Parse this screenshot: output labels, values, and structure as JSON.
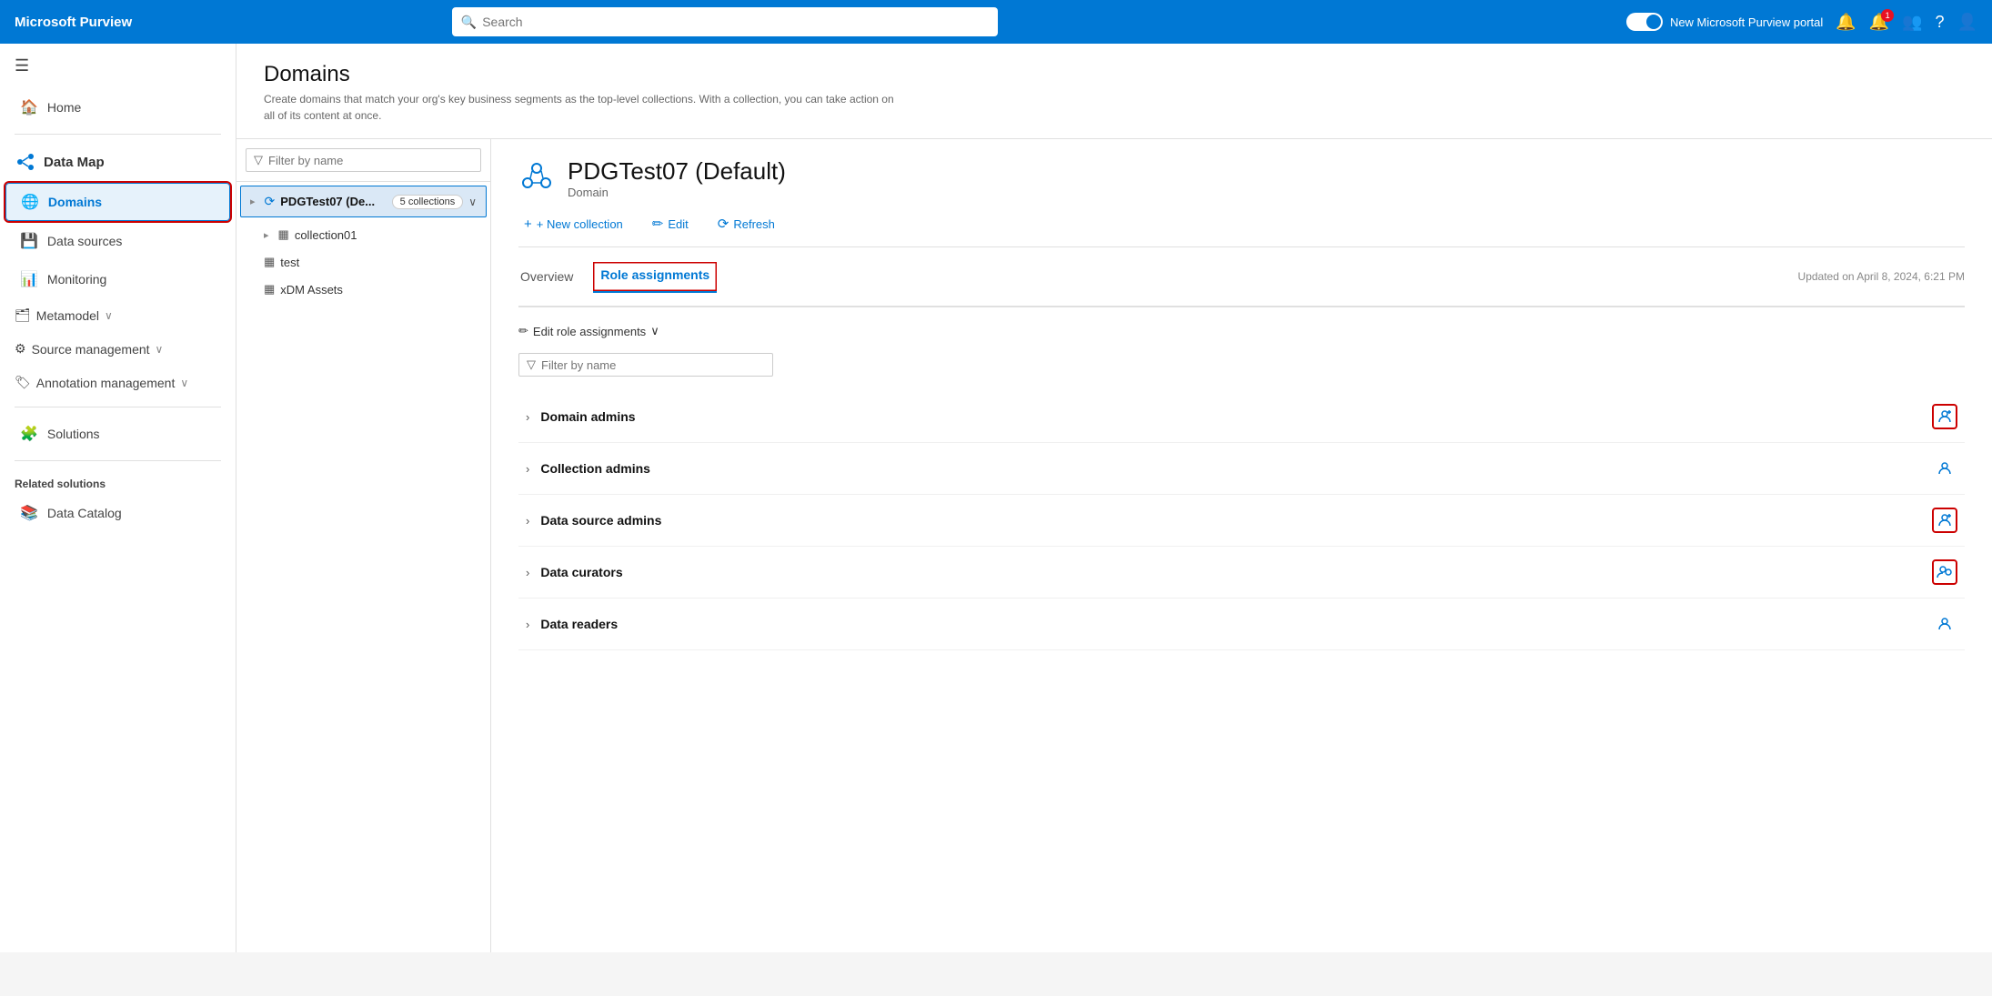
{
  "app": {
    "brand": "Microsoft Purview",
    "toggle_label": "New Microsoft Purview portal"
  },
  "topnav": {
    "search_placeholder": "Search"
  },
  "sidebar": {
    "hamburger": "☰",
    "home_label": "Home",
    "data_map_label": "Data Map",
    "items": [
      {
        "id": "domains",
        "label": "Domains",
        "active": true
      },
      {
        "id": "data-sources",
        "label": "Data sources",
        "active": false
      },
      {
        "id": "monitoring",
        "label": "Monitoring",
        "active": false
      },
      {
        "id": "metamodel",
        "label": "Metamodel",
        "active": false,
        "has_chevron": true
      },
      {
        "id": "source-management",
        "label": "Source management",
        "active": false,
        "has_chevron": true
      },
      {
        "id": "annotation-management",
        "label": "Annotation management",
        "active": false,
        "has_chevron": true
      }
    ],
    "divider_after_metamodel": true,
    "solutions_label": "Solutions",
    "solutions_item": "Solutions",
    "related_solutions_label": "Related solutions",
    "related_solutions_items": [
      {
        "id": "data-catalog",
        "label": "Data Catalog"
      }
    ]
  },
  "page": {
    "title": "Domains",
    "subtitle": "Create domains that match your org's key business segments as the top-level collections. With a collection, you can take action on all of its content at once."
  },
  "filter": {
    "placeholder": "Filter by name"
  },
  "collections": {
    "root": {
      "name": "PDGTest07 (De...",
      "badge": "5 collections",
      "expanded": true
    },
    "children": [
      {
        "name": "collection01"
      },
      {
        "name": "test"
      },
      {
        "name": "xDM Assets"
      }
    ]
  },
  "domain": {
    "title": "PDGTest07 (Default)",
    "type": "Domain",
    "toolbar": {
      "new_collection": "+ New collection",
      "edit": "Edit",
      "refresh": "Refresh"
    },
    "tabs": [
      {
        "id": "overview",
        "label": "Overview",
        "active": false
      },
      {
        "id": "role-assignments",
        "label": "Role assignments",
        "active": true
      }
    ],
    "updated": "Updated on April 8, 2024, 6:21 PM",
    "edit_role_btn": "Edit role assignments",
    "role_filter_placeholder": "Filter by name",
    "roles": [
      {
        "id": "domain-admins",
        "name": "Domain admins",
        "has_red_box": true
      },
      {
        "id": "collection-admins",
        "name": "Collection admins",
        "has_red_box": false
      },
      {
        "id": "data-source-admins",
        "name": "Data source admins",
        "has_red_box": true
      },
      {
        "id": "data-curators",
        "name": "Data curators",
        "has_red_box": true
      },
      {
        "id": "data-readers",
        "name": "Data readers",
        "has_red_box": false
      }
    ]
  }
}
